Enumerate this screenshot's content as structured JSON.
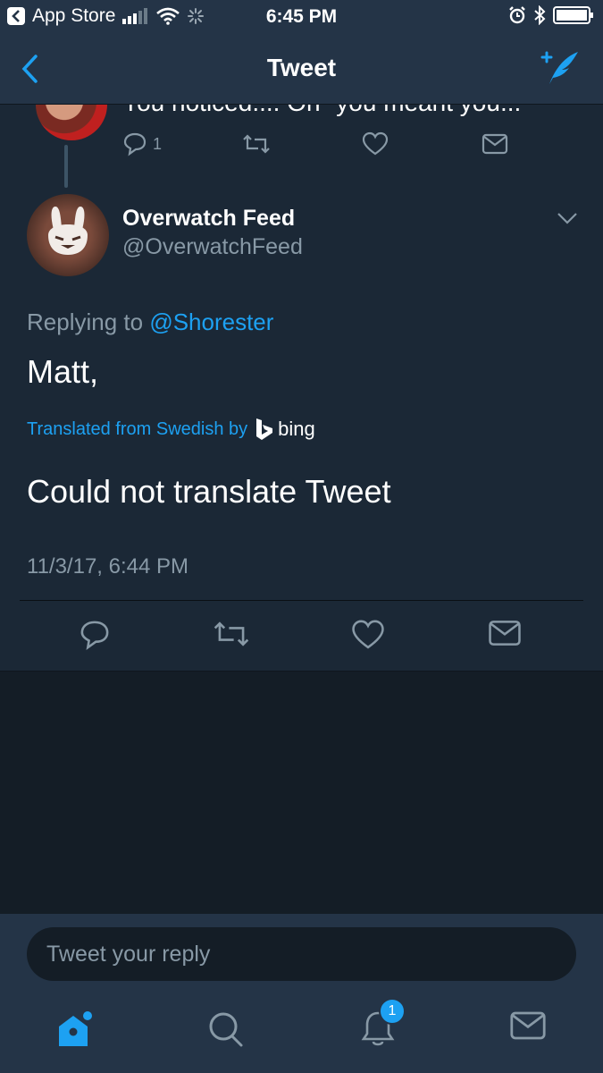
{
  "status_bar": {
    "back_app": "App Store",
    "time": "6:45 PM"
  },
  "nav": {
    "title": "Tweet"
  },
  "previous_tweet": {
    "text": "You noticed.... Oh \"you meant you...",
    "reply_count": "1"
  },
  "tweet": {
    "name": "Overwatch Feed",
    "handle": "@OverwatchFeed",
    "replying_prefix": "Replying to",
    "replying_to": "@Shorester",
    "text": "Matt,",
    "translated_label": "Translated from Swedish by",
    "translator": "bing",
    "translation": "Could not translate Tweet",
    "timestamp": "11/3/17, 6:44 PM"
  },
  "reply": {
    "placeholder": "Tweet your reply"
  },
  "tabs": {
    "notifications_badge": "1"
  },
  "colors": {
    "accent": "#1da1f2",
    "background": "#141d26",
    "surface": "#1b2836",
    "bar": "#243447",
    "muted_text": "#8899a6"
  }
}
